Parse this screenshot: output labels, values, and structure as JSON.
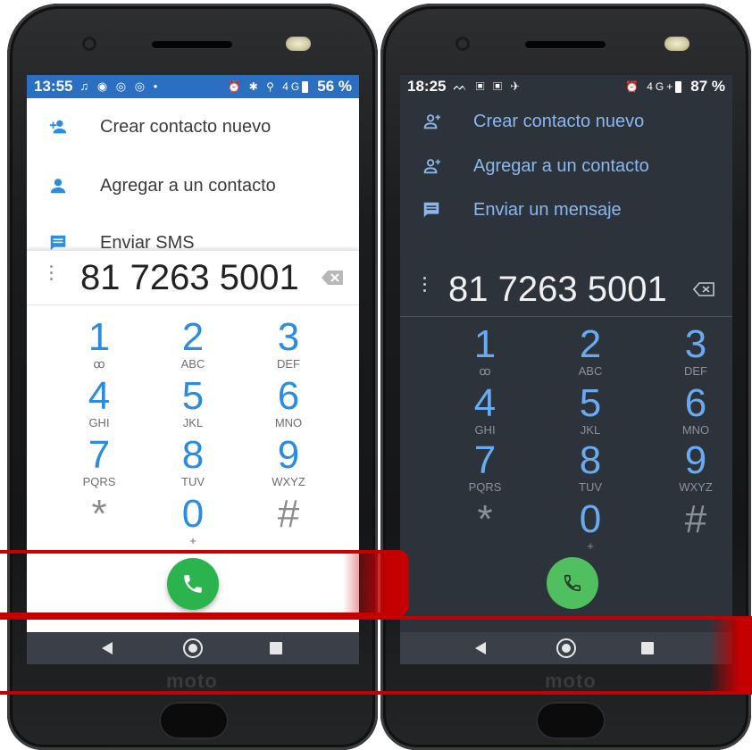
{
  "left_phone": {
    "brand": "moto",
    "status": {
      "time": "13:55",
      "left_icons": "♫ ◉ ◎ ◎ •",
      "right_icons": "⏰ ✱ ⚲ 4G",
      "battery": "56 %"
    },
    "menu": [
      {
        "label": "Crear contacto nuevo",
        "icon": "add-contact-icon"
      },
      {
        "label": "Agregar a un contacto",
        "icon": "person-icon"
      },
      {
        "label": "Enviar SMS",
        "icon": "message-icon"
      }
    ],
    "number": "81 7263 5001",
    "keys": [
      {
        "digit": "1",
        "letters": "ꝏ"
      },
      {
        "digit": "2",
        "letters": "ABC"
      },
      {
        "digit": "3",
        "letters": "DEF"
      },
      {
        "digit": "4",
        "letters": "GHI"
      },
      {
        "digit": "5",
        "letters": "JKL"
      },
      {
        "digit": "6",
        "letters": "MNO"
      },
      {
        "digit": "7",
        "letters": "PQRS"
      },
      {
        "digit": "8",
        "letters": "TUV"
      },
      {
        "digit": "9",
        "letters": "WXYZ"
      },
      {
        "digit": "*",
        "letters": ""
      },
      {
        "digit": "0",
        "letters": "+"
      },
      {
        "digit": "#",
        "letters": ""
      }
    ]
  },
  "right_phone": {
    "brand": "moto",
    "status": {
      "time": "18:25",
      "left_icons": "ᨓ ▣ ▣ ✈",
      "right_icons": "⏰ 4G+",
      "battery": "87 %"
    },
    "menu": [
      {
        "label": "Crear contacto nuevo",
        "icon": "add-contact-icon"
      },
      {
        "label": "Agregar a un contacto",
        "icon": "add-contact-icon"
      },
      {
        "label": "Enviar un mensaje",
        "icon": "message-icon"
      }
    ],
    "number": "81 7263 5001",
    "keys": [
      {
        "digit": "1",
        "letters": "ꝏ"
      },
      {
        "digit": "2",
        "letters": "ABC"
      },
      {
        "digit": "3",
        "letters": "DEF"
      },
      {
        "digit": "4",
        "letters": "GHI"
      },
      {
        "digit": "5",
        "letters": "JKL"
      },
      {
        "digit": "6",
        "letters": "MNO"
      },
      {
        "digit": "7",
        "letters": "PQRS"
      },
      {
        "digit": "8",
        "letters": "TUV"
      },
      {
        "digit": "9",
        "letters": "WXYZ"
      },
      {
        "digit": "*",
        "letters": ""
      },
      {
        "digit": "0",
        "letters": "+"
      },
      {
        "digit": "#",
        "letters": ""
      }
    ]
  },
  "colors": {
    "highlight": "#c40000",
    "call_green": "#2bb34d",
    "left_status_bar": "#2a6fc0",
    "dark_bg": "#2d333a"
  }
}
